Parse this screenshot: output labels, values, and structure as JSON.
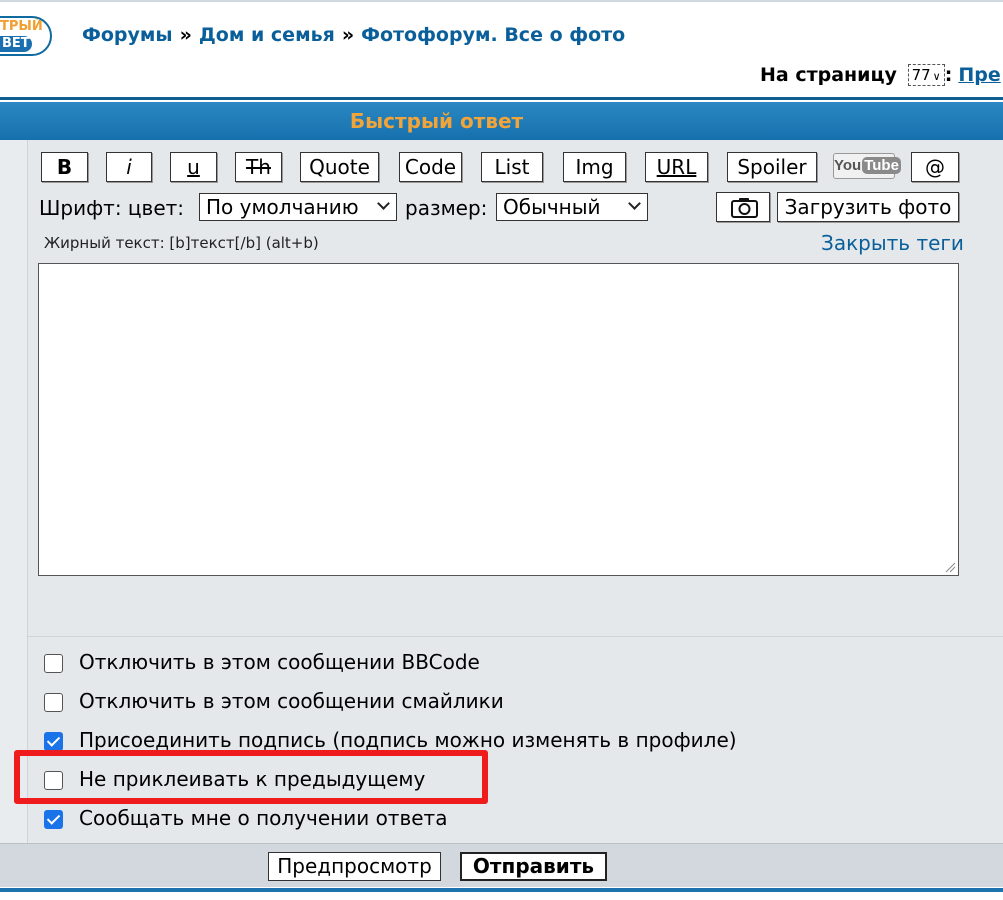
{
  "logo": {
    "line1": "ТРЫЙ",
    "line2": "ВЕТ"
  },
  "breadcrumb": {
    "items": [
      "Форумы",
      "Дом и семья",
      "Фотофорум. Все о фото"
    ],
    "separator": "»"
  },
  "pager": {
    "label": "На страницу",
    "selected_page": "77",
    "next_label": "Пре"
  },
  "banner": {
    "title": "Быстрый ответ"
  },
  "toolbar": {
    "bold": "B",
    "italic": "i",
    "underline": "u",
    "strike": "Th",
    "quote": "Quote",
    "code": "Code",
    "list": "List",
    "img": "Img",
    "url": "URL",
    "spoiler": "Spoiler",
    "youtube_you": "You",
    "youtube_tube": "Tube",
    "mention": "@"
  },
  "font": {
    "label": "Шрифт: цвет:",
    "color_value": "По умолчанию",
    "size_label": "размер:",
    "size_value": "Обычный"
  },
  "upload": {
    "label": "Загрузить фото"
  },
  "hint": {
    "text": "Жирный текст: [b]текст[/b]  (alt+b)"
  },
  "close_tags": {
    "label": "Закрыть теги"
  },
  "options": [
    {
      "label": "Отключить в этом сообщении BBCode",
      "checked": false
    },
    {
      "label": "Отключить в этом сообщении смайлики",
      "checked": false
    },
    {
      "label": "Присоединить подпись (подпись можно изменять в профиле)",
      "checked": true
    },
    {
      "label": "Не приклеивать к предыдущему",
      "checked": false
    },
    {
      "label": "Сообщать мне о получении ответа",
      "checked": true
    }
  ],
  "actions": {
    "preview": "Предпросмотр",
    "submit": "Отправить"
  },
  "colors": {
    "link": "#0a5f9a",
    "banner": "#1a78b5",
    "banner_text": "#f0a43a",
    "highlight": "#ee1c1c",
    "checkbox": "#1a73e8"
  }
}
